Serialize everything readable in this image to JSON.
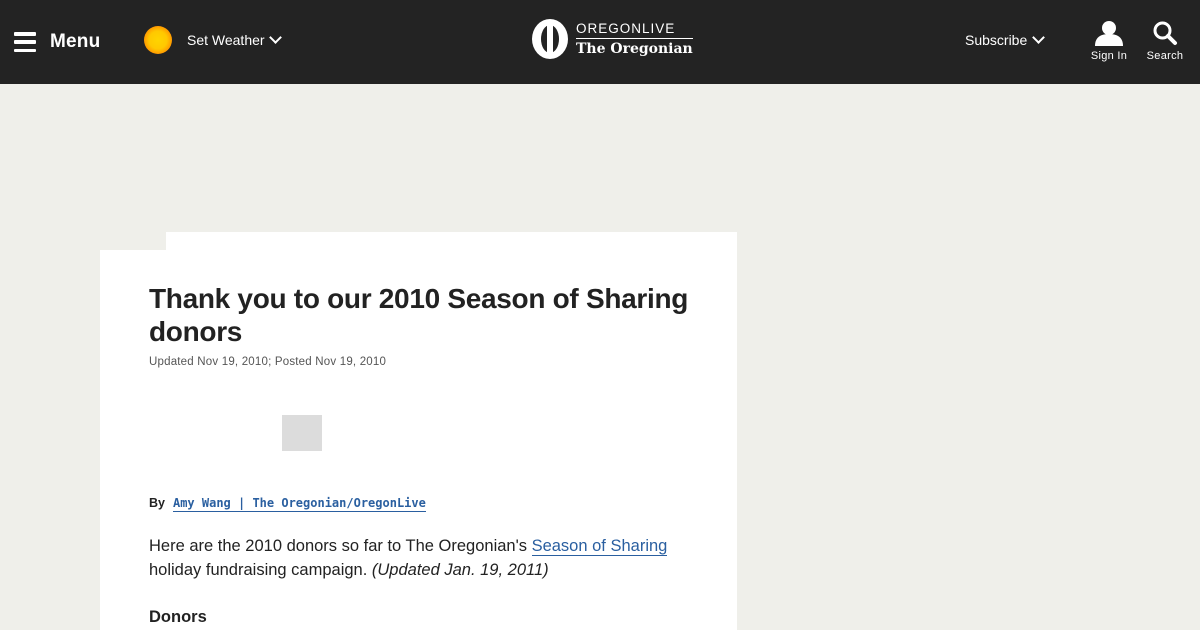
{
  "header": {
    "menu_label": "Menu",
    "weather_label": "Set Weather",
    "logo_top": "OREGONLIVE",
    "logo_bottom": "The Oregonian",
    "subscribe_label": "Subscribe",
    "signin_label": "Sign In",
    "search_label": "Search"
  },
  "article": {
    "title": "Thank you to our 2010 Season of Sharing donors",
    "dateline": "Updated Nov 19, 2010; Posted Nov 19, 2010",
    "byline_prefix": "By",
    "byline_author": "Amy Wang | The Oregonian/OregonLive",
    "body_pre": "Here are the 2010 donors so far to The Oregonian's ",
    "body_link": "Season of Sharing",
    "body_post": " holiday fundraising campaign. ",
    "body_italic": "(Updated Jan. 19, 2011)",
    "section_heading": "Donors"
  },
  "icons": {
    "menu": "hamburger-icon",
    "weather": "sun-icon",
    "signin": "user-icon",
    "search": "search-icon"
  },
  "colors": {
    "header_bg": "#232323",
    "page_bg": "#efefea",
    "link": "#2a5fa0"
  }
}
